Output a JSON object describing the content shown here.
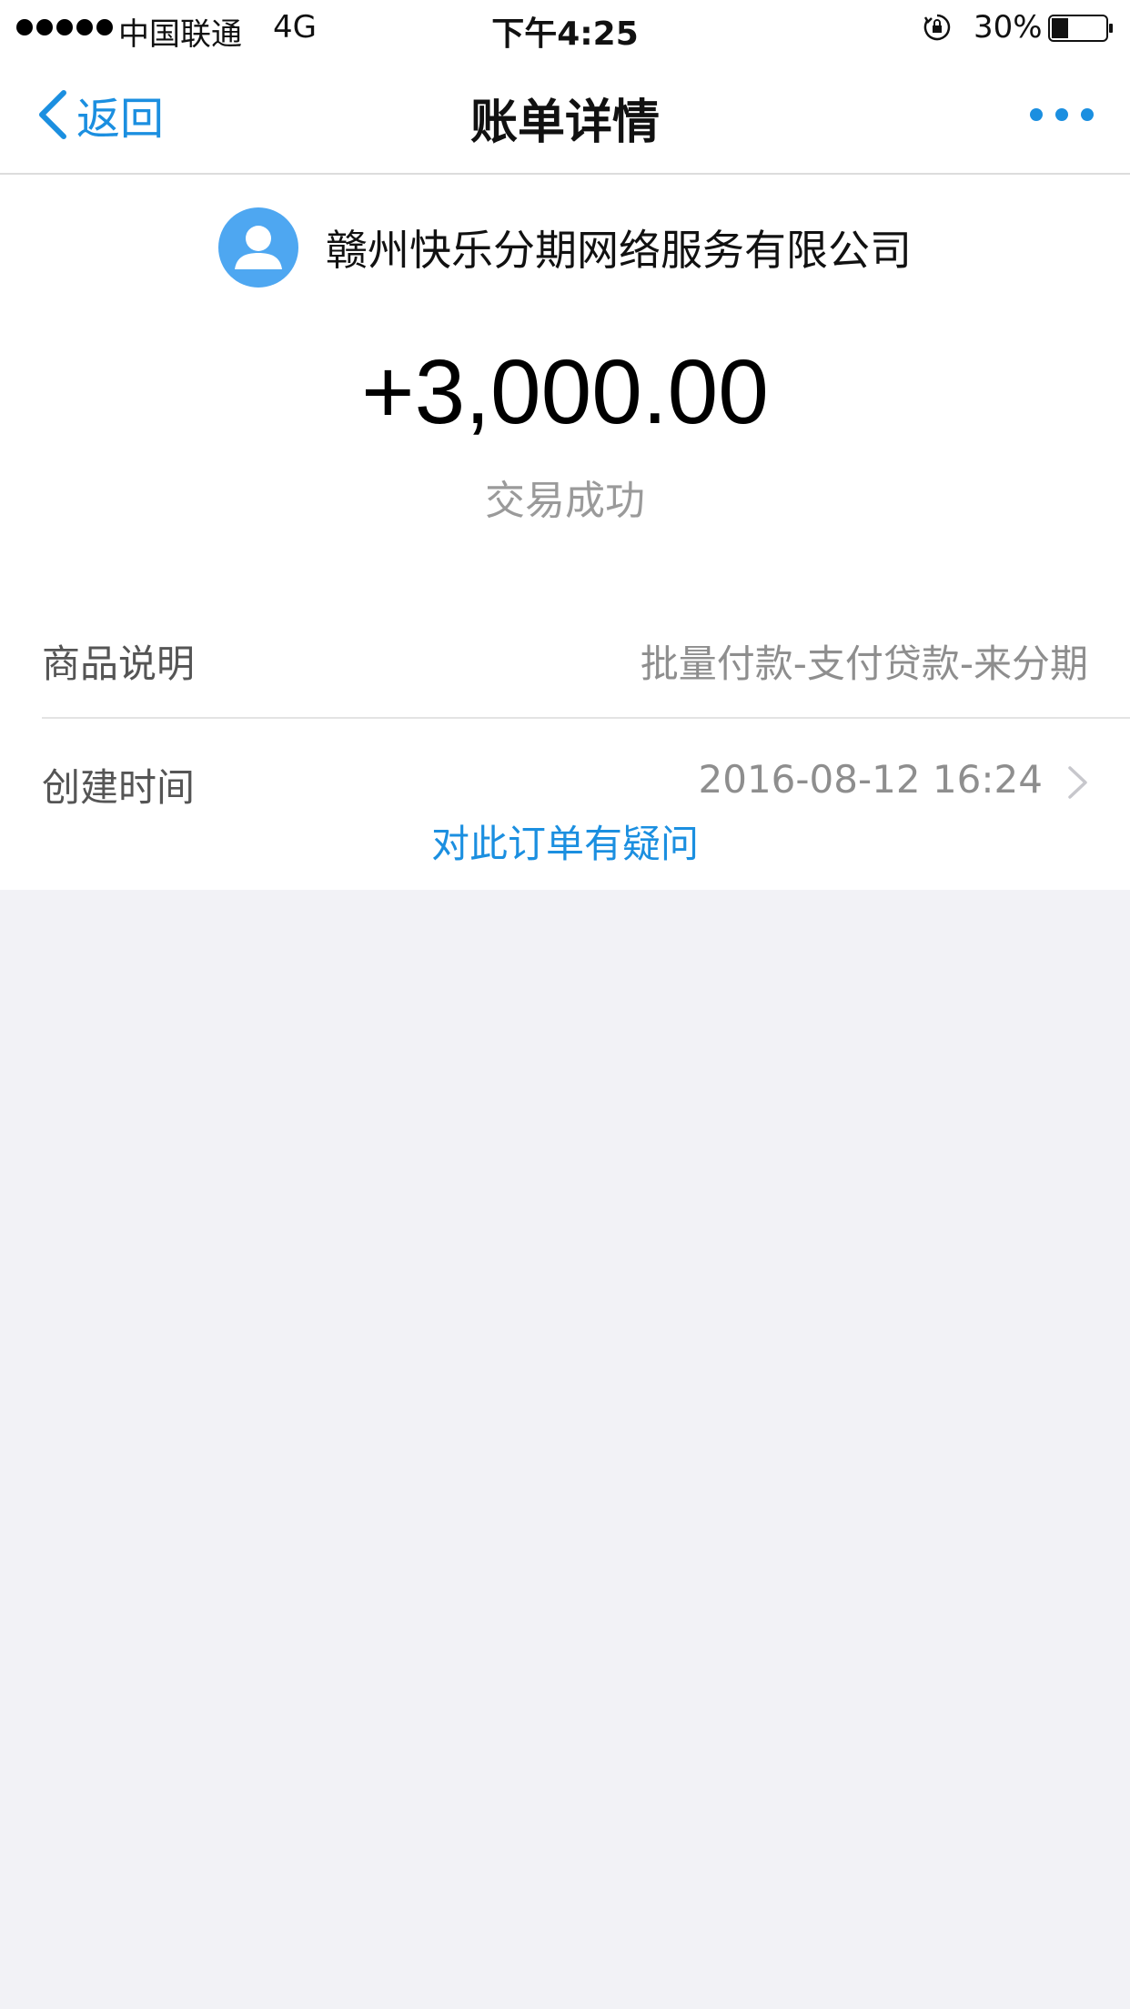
{
  "status_bar": {
    "carrier": "中国联通",
    "network": "4G",
    "time": "下午4:25",
    "battery": "30%"
  },
  "nav": {
    "back_label": "返回",
    "title": "账单详情"
  },
  "merchant": {
    "name": "赣州快乐分期网络服务有限公司"
  },
  "transaction": {
    "amount": "+3,000.00",
    "status": "交易成功"
  },
  "details": [
    {
      "label": "商品说明",
      "value": "批量付款-支付贷款-来分期"
    },
    {
      "label": "创建时间",
      "value": "2016-08-12 16:24"
    }
  ],
  "question_link": "对此订单有疑问",
  "colors": {
    "accent": "#1b8fe0",
    "avatar": "#4ea7f1",
    "background": "#f2f2f6"
  }
}
